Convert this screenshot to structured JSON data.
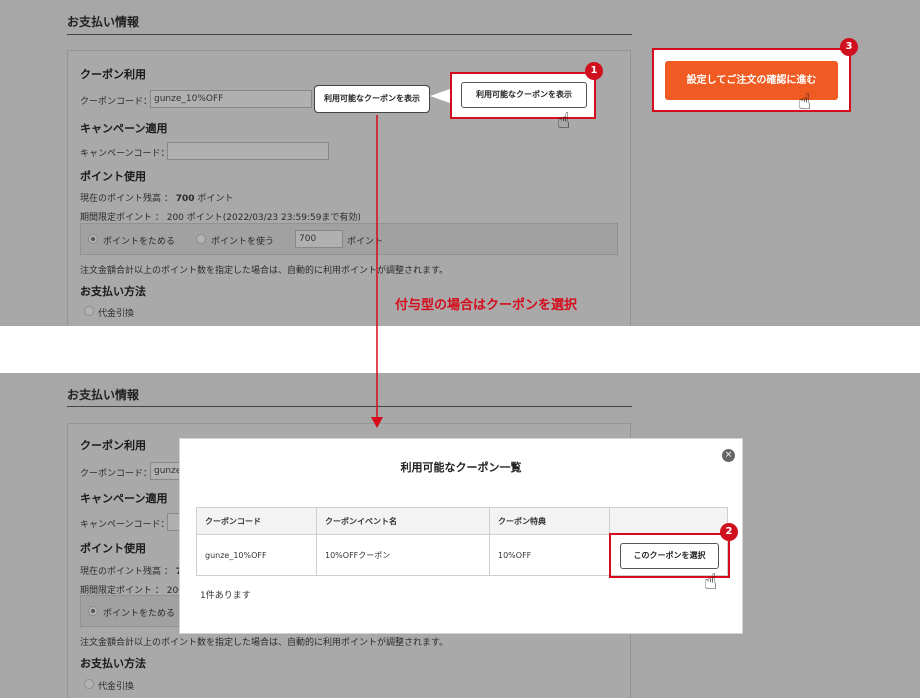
{
  "top": {
    "section_title": "お支払い情報",
    "coupon": {
      "heading": "クーポン利用",
      "label": "クーポンコード：",
      "value": "gunze_10%OFF",
      "show_button": "利用可能なクーポンを表示"
    },
    "campaign": {
      "heading": "キャンペーン適用",
      "label": "キャンペーンコード：",
      "value": ""
    },
    "points": {
      "heading": "ポイント使用",
      "balance_label": "現在のポイント残高 ：",
      "balance_value": "700",
      "balance_unit": "ポイント",
      "limited": "期間限定ポイント ： 200 ポイント(2022/03/23 23:59:59まで有効)",
      "opt_save": "ポイントをためる",
      "opt_use": "ポイントを使う",
      "use_value": "700",
      "use_unit": "ポイント",
      "note": "注文金額合計以上のポイント数を指定した場合は、自動的に利用ポイントが調整されます。"
    },
    "payment": {
      "heading": "お支払い方法",
      "opt_cod": "代金引換"
    }
  },
  "callouts": {
    "badge1": "1",
    "badge2": "2",
    "badge3": "3",
    "show_coupon_btn": "利用可能なクーポンを表示",
    "confirm_btn": "設定してご注文の確認に進む",
    "flow_label": "付与型の場合はクーポンを選択"
  },
  "bottom": {
    "section_title": "お支払い情報",
    "coupon_heading": "クーポン利用",
    "coupon_label": "クーポンコード：",
    "coupon_value": "gunze_",
    "campaign_heading": "キャンペーン適用",
    "campaign_label": "キャンペーンコード：",
    "points_heading": "ポイント使用",
    "balance_label": "現在のポイント残高 ：",
    "balance_value": "70",
    "limited": "期間限定ポイント ： 200",
    "opt_save": "ポイントをためる",
    "note": "注文金額合計以上のポイント数を指定した場合は、自動的に利用ポイントが調整されます。",
    "payment_heading": "お支払い方法",
    "opt_cod": "代金引換"
  },
  "modal": {
    "title": "利用可能なクーポン一覧",
    "close": "×",
    "columns": [
      "クーポンコード",
      "クーポンイベント名",
      "クーポン特典",
      ""
    ],
    "rows": [
      {
        "code": "gunze_10%OFF",
        "event": "10%OFFクーポン",
        "benefit": "10%OFF",
        "action": "このクーポンを選択"
      }
    ],
    "count": "1件あります"
  },
  "colors": {
    "accent": "#d60b1b",
    "confirm": "#ef5b23",
    "overlay": "#a7a7a7"
  }
}
